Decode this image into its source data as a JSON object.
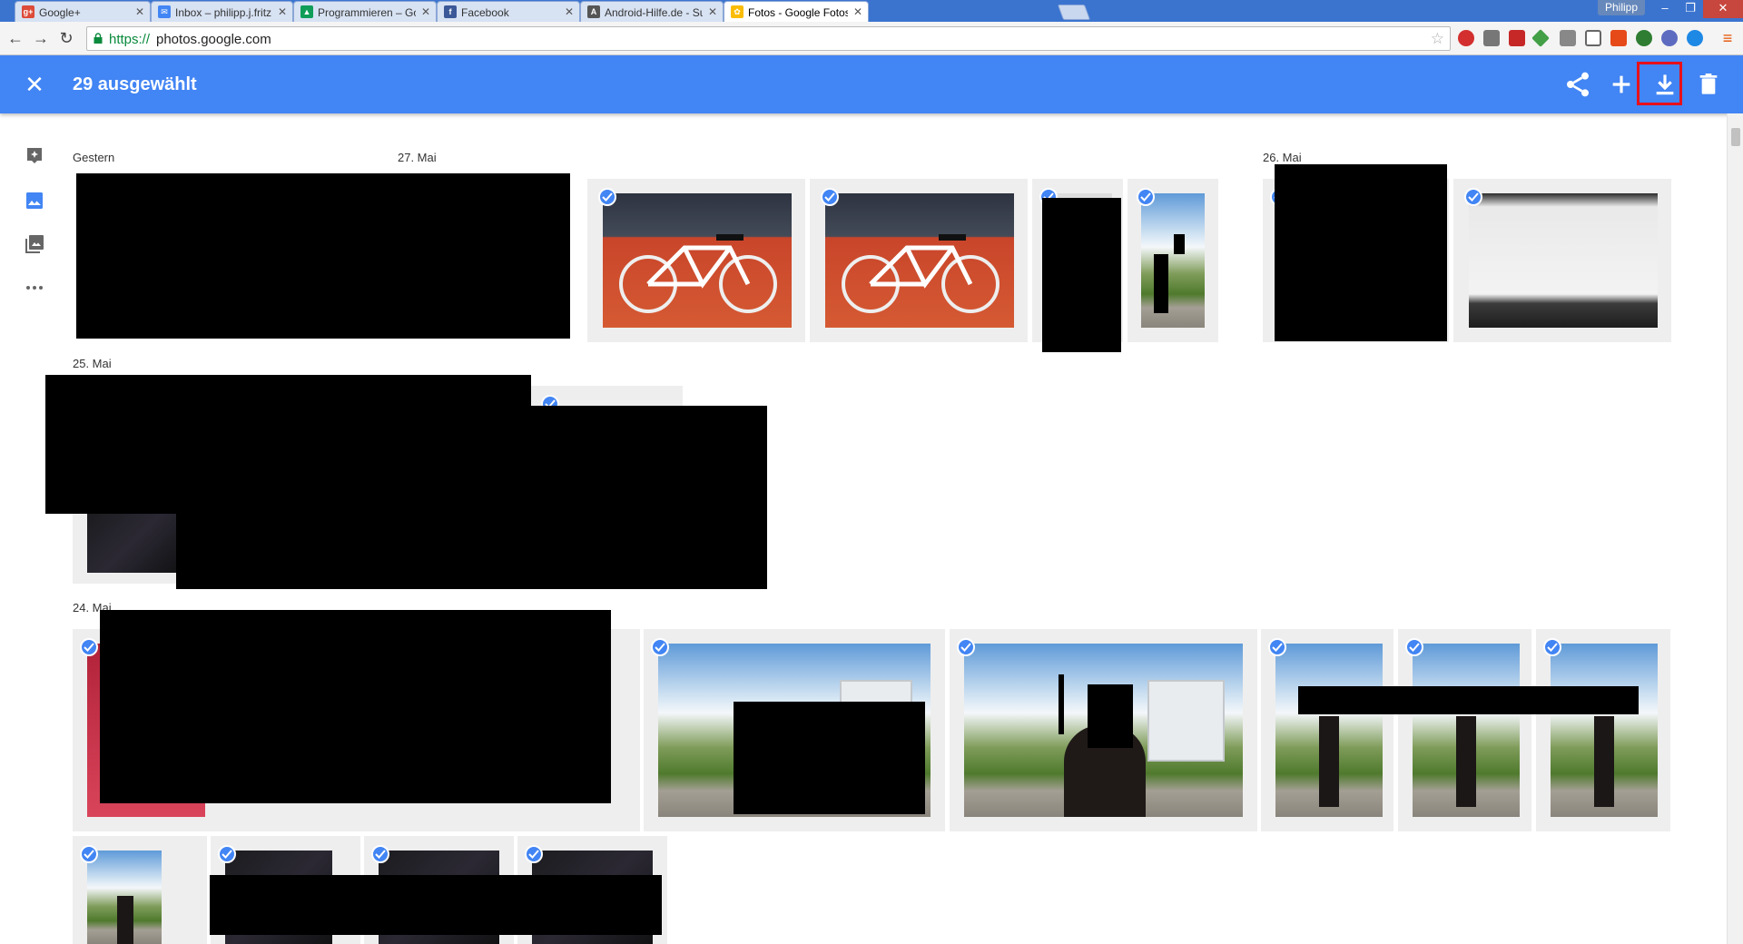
{
  "browser": {
    "tabs": [
      {
        "label": "Google+",
        "favicon": "google-plus-icon",
        "fav_text": "g+",
        "color": "#dd4b39"
      },
      {
        "label": "Inbox – philipp.j.fritz@gm",
        "favicon": "inbox-icon",
        "fav_text": "✉",
        "color": "#4285f4"
      },
      {
        "label": "Programmieren – Google",
        "favicon": "google-drive-icon",
        "fav_text": "▲",
        "color": "#f4b400"
      },
      {
        "label": "Facebook",
        "favicon": "facebook-icon",
        "fav_text": "f",
        "color": "#3b5998"
      },
      {
        "label": "Android-Hilfe.de - Suchen",
        "favicon": "android-icon",
        "fav_text": "A",
        "color": "#555555"
      },
      {
        "label": "Fotos - Google Fotos",
        "favicon": "google-photos-icon",
        "fav_text": "✿",
        "color": "#fbbc05"
      }
    ],
    "profile_name": "Philipp",
    "url_scheme": "https://",
    "url_host": "photos.google.com"
  },
  "appbar": {
    "selection_count": "29 ausgewählt",
    "color": "#4285f4",
    "actions": [
      "share-icon",
      "add-icon",
      "download-icon",
      "delete-icon"
    ]
  },
  "leftnav": [
    "assistant-icon",
    "photos-icon",
    "albums-icon",
    "more-icon"
  ],
  "sections": {
    "yesterday": "Gestern",
    "may27": "27. Mai",
    "may26": "26. Mai",
    "may25": "25. Mai",
    "may24": "24. Mai"
  }
}
